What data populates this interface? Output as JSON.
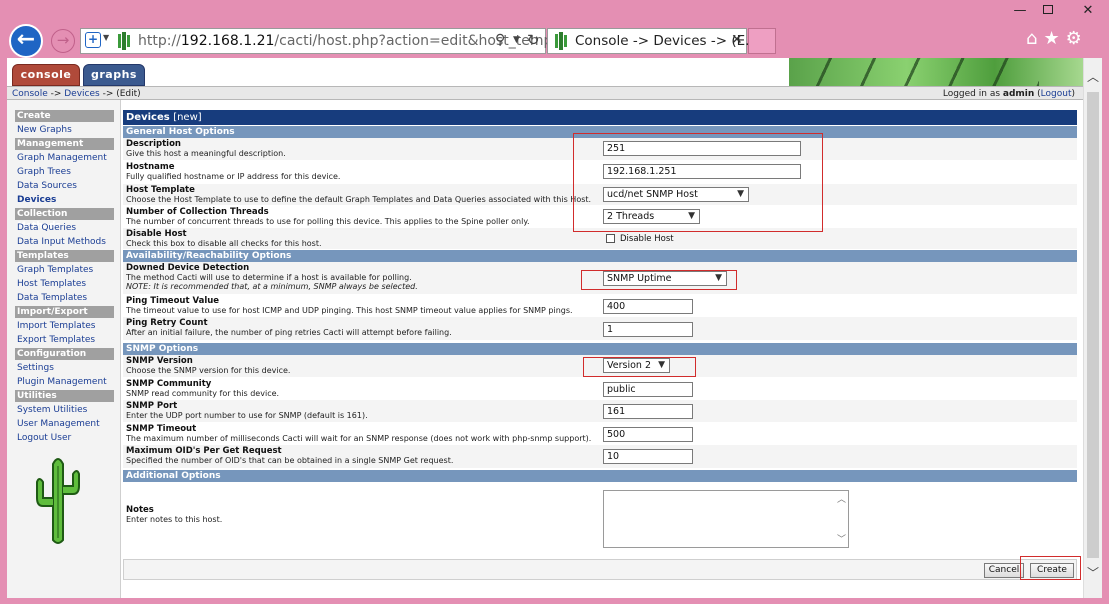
{
  "browser": {
    "address_prefix": "http://",
    "address_host": "192.168.1.21",
    "address_path": "/cacti/host.php?action=edit&host_templat",
    "tab_title": "Console -> Devices -> (E...",
    "tab_close": "✕",
    "icons": [
      "home-icon",
      "star-icon",
      "gear-icon"
    ]
  },
  "header": {
    "tabs": [
      {
        "label": "console"
      },
      {
        "label": "graphs"
      }
    ],
    "breadcrumb": {
      "console": "Console",
      "sep1": " -> ",
      "devices": "Devices",
      "sep2": " -> ",
      "edit": "(Edit)"
    },
    "login": {
      "prefix": "Logged in as ",
      "user": "admin",
      "logout": "Logout"
    }
  },
  "sidebar": {
    "groups": [
      {
        "title": "Create",
        "items": [
          "New Graphs"
        ]
      },
      {
        "title": "Management",
        "items": [
          "Graph Management",
          "Graph Trees",
          "Data Sources",
          "Devices"
        ]
      },
      {
        "title": "Collection Methods",
        "items": [
          "Data Queries",
          "Data Input Methods"
        ]
      },
      {
        "title": "Templates",
        "items": [
          "Graph Templates",
          "Host Templates",
          "Data Templates"
        ]
      },
      {
        "title": "Import/Export",
        "items": [
          "Import Templates",
          "Export Templates"
        ]
      },
      {
        "title": "Configuration",
        "items": [
          "Settings",
          "Plugin Management"
        ]
      },
      {
        "title": "Utilities",
        "items": [
          "System Utilities",
          "User Management",
          "Logout User"
        ]
      }
    ],
    "active_item": "Devices"
  },
  "form": {
    "title": "Devices",
    "title_suffix": "[new]",
    "sections": {
      "general": "General Host Options",
      "availability": "Availability/Reachability Options",
      "snmp": "SNMP Options",
      "additional": "Additional Options"
    },
    "description": {
      "name": "Description",
      "desc": "Give this host a meaningful description.",
      "value": "251"
    },
    "hostname": {
      "name": "Hostname",
      "desc": "Fully qualified hostname or IP address for this device.",
      "value": "192.168.1.251"
    },
    "host_template": {
      "name": "Host Template",
      "desc": "Choose the Host Template to use to define the default Graph Templates and Data Queries associated with this Host.",
      "value": "ucd/net SNMP Host"
    },
    "threads": {
      "name": "Number of Collection Threads",
      "desc": "The number of concurrent threads to use for polling this device. This applies to the Spine poller only.",
      "value": "2 Threads"
    },
    "disable_host": {
      "name": "Disable Host",
      "desc": "Check this box to disable all checks for this host.",
      "label": "Disable Host",
      "checked": false
    },
    "downed_detection": {
      "name": "Downed Device Detection",
      "desc": "The method Cacti will use to determine if a host is available for polling.",
      "note": "NOTE: It is recommended that, at a minimum, SNMP always be selected.",
      "value": "SNMP Uptime"
    },
    "ping_timeout": {
      "name": "Ping Timeout Value",
      "desc": "The timeout value to use for host ICMP and UDP pinging. This host SNMP timeout value applies for SNMP pings.",
      "value": "400"
    },
    "ping_retry": {
      "name": "Ping Retry Count",
      "desc": "After an initial failure, the number of ping retries Cacti will attempt before failing.",
      "value": "1"
    },
    "snmp_version": {
      "name": "SNMP Version",
      "desc": "Choose the SNMP version for this device.",
      "value": "Version 2"
    },
    "snmp_community": {
      "name": "SNMP Community",
      "desc": "SNMP read community for this device.",
      "value": "public"
    },
    "snmp_port": {
      "name": "SNMP Port",
      "desc": "Enter the UDP port number to use for SNMP (default is 161).",
      "value": "161"
    },
    "snmp_timeout": {
      "name": "SNMP Timeout",
      "desc": "The maximum number of milliseconds Cacti will wait for an SNMP response (does not work with php-snmp support).",
      "value": "500"
    },
    "max_oids": {
      "name": "Maximum OID's Per Get Request",
      "desc": "Specified the number of OID's that can be obtained in a single SNMP Get request.",
      "value": "10"
    },
    "notes": {
      "name": "Notes",
      "desc": "Enter notes to this host.",
      "value": ""
    },
    "buttons": {
      "cancel": "Cancel",
      "create": "Create"
    }
  }
}
